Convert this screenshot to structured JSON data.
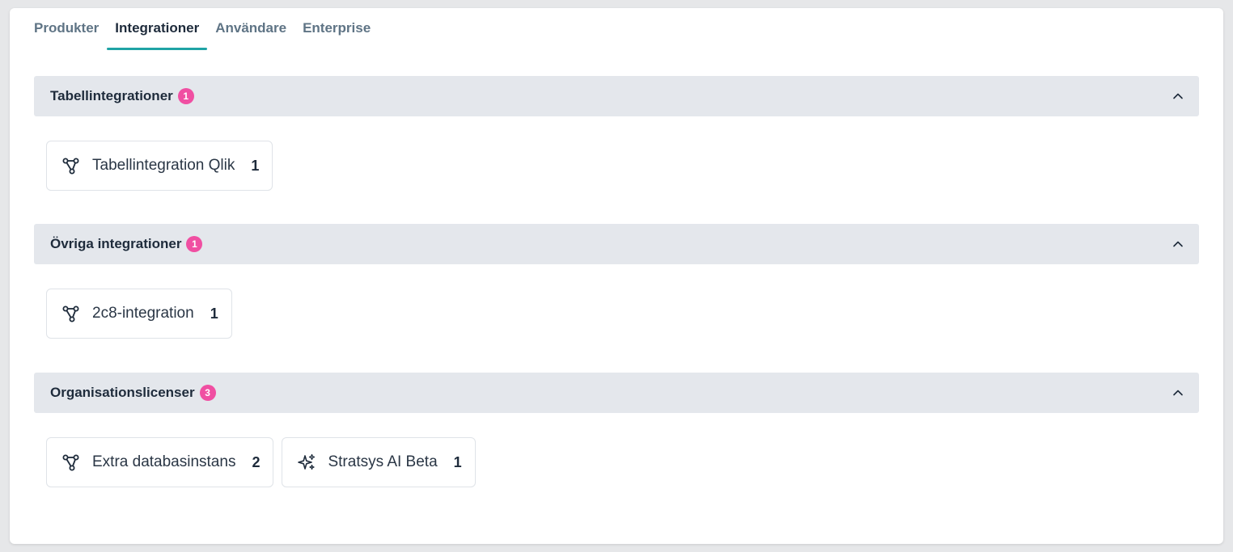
{
  "tabs": [
    {
      "label": "Produkter",
      "active": false
    },
    {
      "label": "Integrationer",
      "active": true
    },
    {
      "label": "Användare",
      "active": false
    },
    {
      "label": "Enterprise",
      "active": false
    }
  ],
  "sections": [
    {
      "title": "Tabellintegrationer",
      "badge": "1",
      "collapse_icon": "chevron-up-icon",
      "items": [
        {
          "icon": "integration-icon",
          "label": "Tabellintegration Qlik",
          "count": "1"
        }
      ]
    },
    {
      "title": "Övriga integrationer",
      "badge": "1",
      "collapse_icon": "chevron-up-icon",
      "items": [
        {
          "icon": "integration-icon",
          "label": "2c8-integration",
          "count": "1"
        }
      ]
    },
    {
      "title": "Organisationslicenser",
      "badge": "3",
      "collapse_icon": "chevron-up-icon",
      "items": [
        {
          "icon": "integration-icon",
          "label": "Extra databasinstans",
          "count": "2"
        },
        {
          "icon": "sparkles-icon",
          "label": "Stratsys AI Beta",
          "count": "1"
        }
      ]
    }
  ],
  "colors": {
    "accent": "#1fa3a5",
    "badge": "#f04fa2",
    "section_header_bg": "#e4e7ec",
    "text_dark": "#1e2b3b",
    "tab_inactive": "#5f7485"
  }
}
